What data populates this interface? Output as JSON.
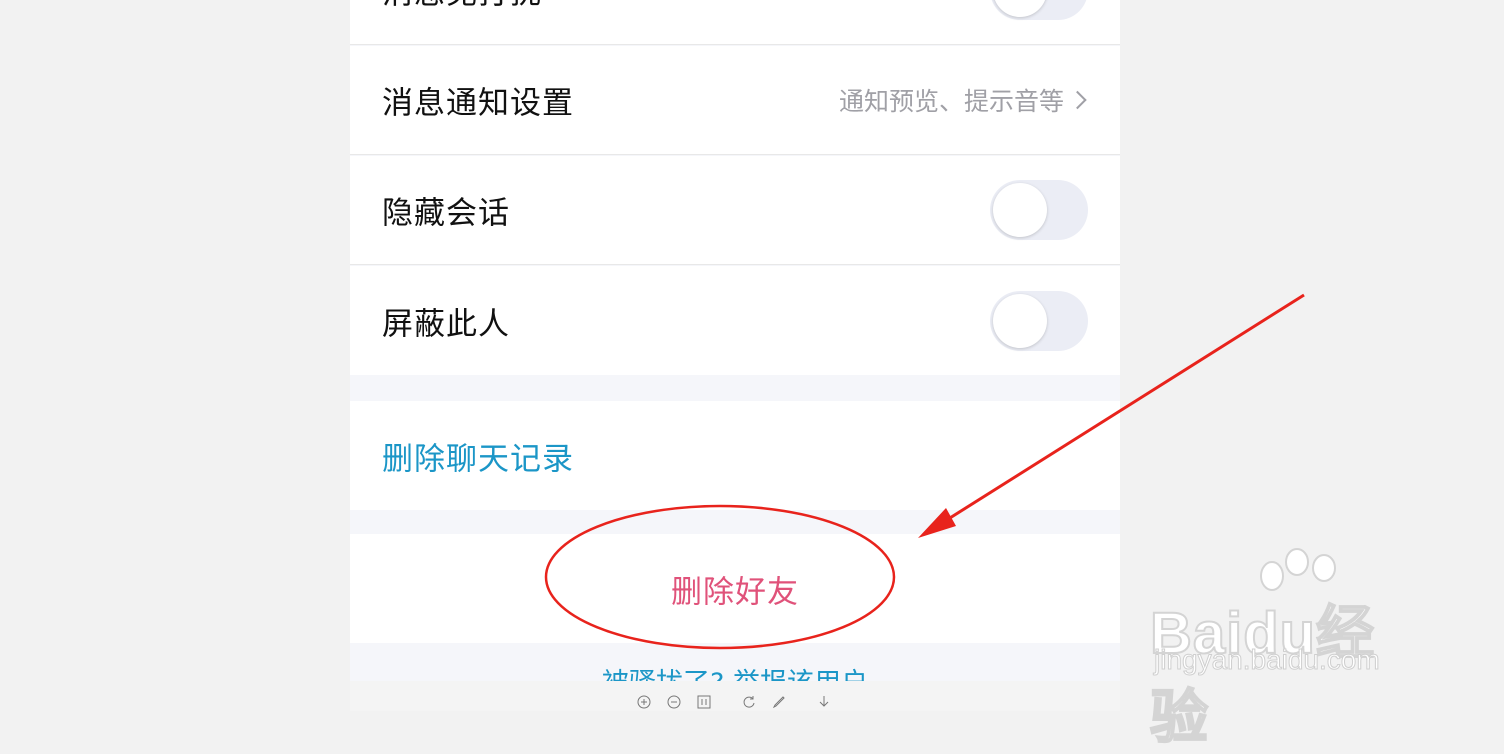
{
  "settings": {
    "rows": [
      {
        "label": "消息免打扰",
        "type": "toggle",
        "on": false
      },
      {
        "label": "消息通知设置",
        "hint": "通知预览、提示音等"
      },
      {
        "label": "隐藏会话",
        "type": "toggle",
        "on": false
      },
      {
        "label": "屏蔽此人",
        "type": "toggle",
        "on": false
      }
    ],
    "delete_history": "删除聊天记录",
    "delete_friend": "删除好友",
    "report": "被骚扰了? 举报该用户"
  },
  "toolbar": {
    "icons": [
      "zoom-in-icon",
      "zoom-out-icon",
      "fit-icon",
      "rotate-icon",
      "edit-icon",
      "download-icon"
    ]
  },
  "watermark": {
    "brand": "Baidu经验",
    "url": "jingyan.baidu.com"
  },
  "annotation": {
    "color": "#e8231c"
  }
}
